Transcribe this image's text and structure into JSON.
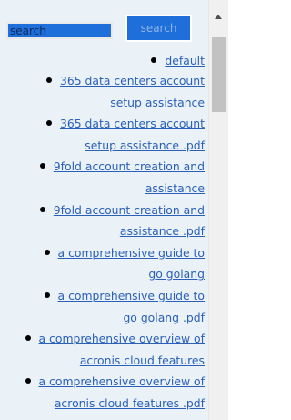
{
  "search": {
    "placeholder": "search",
    "button_label": "search"
  },
  "items": [
    {
      "label": "default"
    },
    {
      "label": "365 data centers account setup assistance"
    },
    {
      "label": "365 data centers account setup assistance .pdf"
    },
    {
      "label": "9fold account creation and assistance"
    },
    {
      "label": "9fold account creation and assistance .pdf"
    },
    {
      "label": "a comprehensive guide to go golang"
    },
    {
      "label": "a comprehensive guide to go golang .pdf"
    },
    {
      "label": "a comprehensive overview of acronis cloud features"
    },
    {
      "label": "a comprehensive overview of acronis cloud features .pdf"
    }
  ],
  "scrollbar": {
    "up_icon": "triangle-up"
  },
  "colors": {
    "page_background": "#eaf1f7",
    "search_blue": "#1e6fd9",
    "link": "#2a60b8"
  }
}
